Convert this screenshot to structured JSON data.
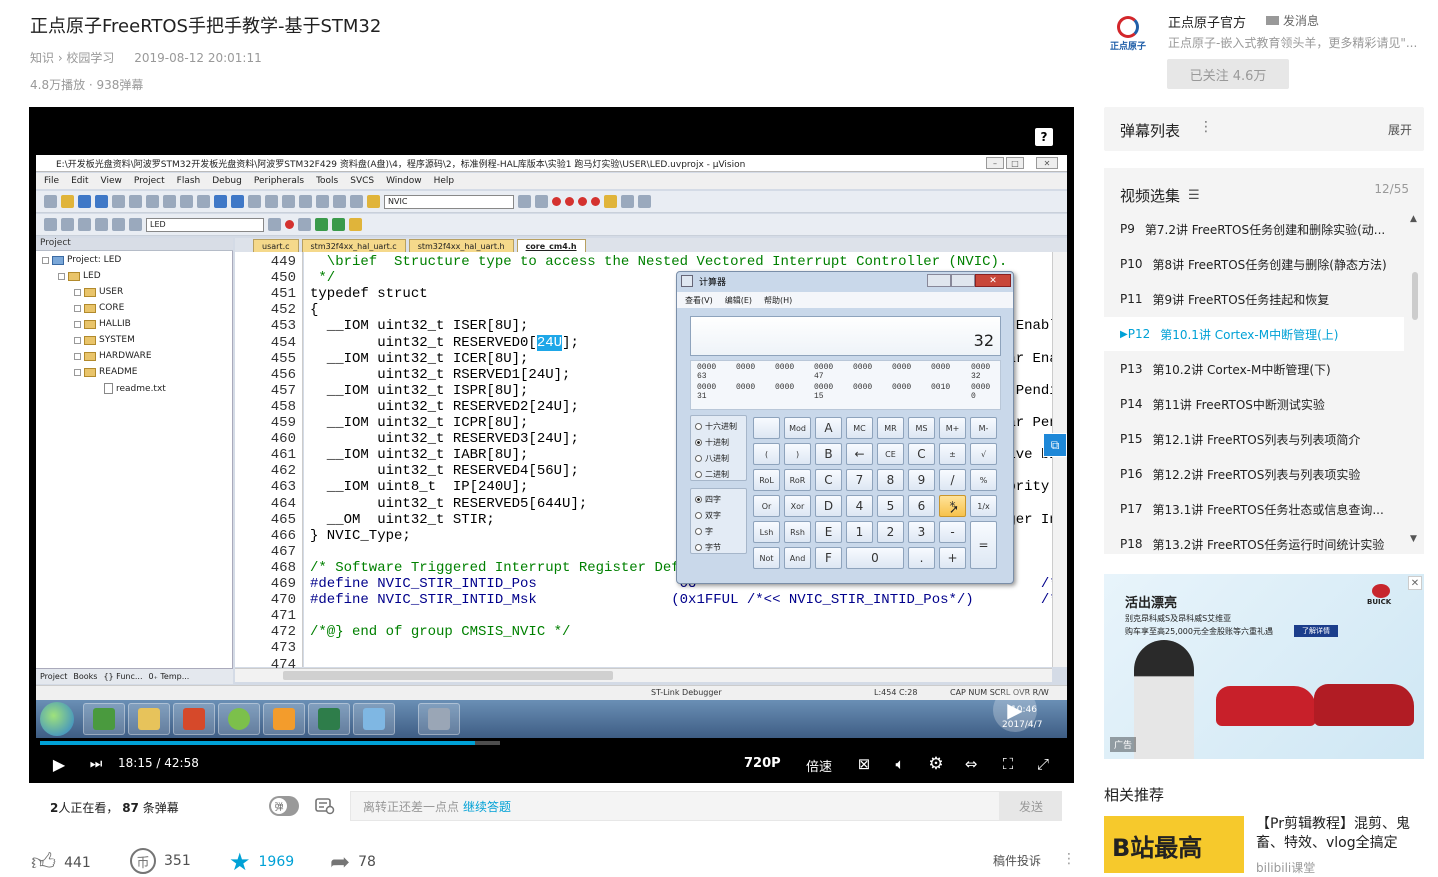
{
  "video": {
    "title": "正点原子FreeRTOS手把手教学-基于STM32",
    "category": "知识 › 校园学习",
    "date": "2019-08-12 20:01:11",
    "stats": "4.8万播放 · 938弹幕"
  },
  "uploader": {
    "avatar_text": "正点原子",
    "name": "正点原子官方",
    "message": "发消息",
    "desc": "正点原子-嵌入式教育领头羊，更多精彩请见\"...",
    "follow": "已关注 4.6万"
  },
  "player": {
    "help": "?",
    "time": "18:15 / 42:58",
    "quality": "720P",
    "speed": "倍速",
    "progress_fraction": 0.4247
  },
  "uvision": {
    "title": "E:\\开发板光盘资料\\阿波罗STM32开发板光盘资料\\阿波罗STM32F429 资料盘(A盘)\\4，程序源码\\2，标准例程-HAL库版本\\实验1 跑马灯实验\\USER\\LED.uvprojx - µVision",
    "menu": [
      "File",
      "Edit",
      "View",
      "Project",
      "Flash",
      "Debug",
      "Peripherals",
      "Tools",
      "SVCS",
      "Window",
      "Help"
    ],
    "toolbar_box1": "NVIC",
    "toolbar_box2": "LED",
    "project_header": "Project",
    "tree": [
      "Project: LED",
      "LED",
      "USER",
      "CORE",
      "HALLIB",
      "SYSTEM",
      "HARDWARE",
      "README",
      "readme.txt"
    ],
    "panel_tabs": [
      "Project",
      "Books",
      "{} Func...",
      "0₊ Temp..."
    ],
    "file_tabs": [
      "usart.c",
      "stm32f4xx_hal_uart.c",
      "stm32f4xx_hal_uart.h",
      "core_cm4.h"
    ],
    "line_numbers": [
      "449",
      "450",
      "451",
      "452",
      "453",
      "454",
      "455",
      "456",
      "457",
      "458",
      "459",
      "460",
      "461",
      "462",
      "463",
      "464",
      "465",
      "466",
      "467",
      "468",
      "469",
      "470",
      "471",
      "472",
      "473",
      "474"
    ],
    "code": [
      "  \\brief  Structure type to access the Nested Vectored Interrupt Controller (NVIC).",
      " */",
      "typedef struct",
      "{",
      "  __IOM uint32_t ISER[8U];                  /*!< Offset: 0x000 (R/W)  Interrupt Set Enable Regi",
      "        uint32_t RESERVED0[24U];",
      "  __IOM uint32_t ICER[8U];                  /*!< Offset: 0x080 (R/W)  Interrupt Clear Enable Re",
      "        uint32_t RSERVED1[24U];",
      "  __IOM uint32_t ISPR[8U];                  /*!< Offset: 0x100 (R/W)  Interrupt Set Pending Reg",
      "        uint32_t RESERVED2[24U];",
      "  __IOM uint32_t ICPR[8U];                  /*!< Offset: 0x180 (R/W)  Interrupt Clear Pending R",
      "        uint32_t RESERVED3[24U];",
      "  __IOM uint32_t IABR[8U];                  /*!< Offset: 0x200 (R/W)  Interrupt Active bit Regi",
      "        uint32_t RESERVED4[56U];",
      "  __IOM uint8_t  IP[240U];                  /*!< Offset: 0x300 (R/W)  Interrupt Priority Regist",
      "        uint32_t RESERVED5[644U];",
      "  __OM  uint32_t STIR;                      /*!< Offset: 0xE00 ( /W)  Software Trigger Interrup",
      "} NVIC_Type;",
      "",
      "/* Software Triggered Interrupt Register Definitions */",
      "#define NVIC_STIR_INTID_Pos                 0U                                         /*!<",
      "#define NVIC_STIR_INTID_Msk                (0x1FFUL /*<< NVIC_STIR_INTID_Pos*/)        /*!<",
      "",
      "/*@} end of group CMSIS_NVIC */",
      "",
      ""
    ],
    "status_debugger": "ST-Link Debugger",
    "status_pos": "L:454 C:28",
    "status_flags": "CAP  NUM  SCRL  OVR  R/W",
    "clock_time": "10:46",
    "clock_date": "2017/4/7"
  },
  "calculator": {
    "title": "计算器",
    "menu": [
      "查看(V)",
      "编辑(E)",
      "帮助(H)"
    ],
    "display": "32",
    "bits_row1": [
      "0000",
      "0000",
      "0000",
      "0000",
      "0000",
      "0000",
      "0000",
      "0000"
    ],
    "bits_lbl1": [
      "63",
      "",
      "",
      "47",
      "",
      "",
      "",
      "32"
    ],
    "bits_row2": [
      "0000",
      "0000",
      "0000",
      "0000",
      "0000",
      "0000",
      "0010",
      "0000"
    ],
    "bits_lbl2": [
      "31",
      "",
      "",
      "15",
      "",
      "",
      "",
      "0"
    ],
    "radix": [
      "十六进制",
      "十进制",
      "八进制",
      "二进制"
    ],
    "word": [
      "四字",
      "双字",
      "字",
      "字节"
    ],
    "keys": [
      [
        "",
        "Mod",
        "A",
        "MC",
        "MR",
        "MS",
        "M+",
        "M-"
      ],
      [
        "(",
        ")",
        "B",
        "←",
        "CE",
        "C",
        "±",
        "√"
      ],
      [
        "RoL",
        "RoR",
        "C",
        "7",
        "8",
        "9",
        "/",
        "%"
      ],
      [
        "Or",
        "Xor",
        "D",
        "4",
        "5",
        "6",
        "*",
        "1/x"
      ],
      [
        "Lsh",
        "Rsh",
        "E",
        "1",
        "2",
        "3",
        "-",
        "="
      ],
      [
        "Not",
        "And",
        "F",
        "0",
        ".",
        "+"
      ]
    ]
  },
  "danmaku_bar": {
    "viewers": "2",
    "viewers_suffix": "人正在看，",
    "danmaku_count": "87",
    "danmaku_suffix": "条弹幕",
    "toggle": "弹",
    "placeholder": "离转正还差一点点",
    "link": "继续答题",
    "send": "发送"
  },
  "actions": {
    "like": "441",
    "coin": "351",
    "favorite": "1969",
    "share": "78",
    "report": "稿件投诉"
  },
  "right": {
    "danmaku_list": "弹幕列表",
    "expand": "展开",
    "episodes_title": "视频选集",
    "episodes_count": "12/55",
    "episodes": [
      {
        "num": "P9",
        "title": "第7.2讲 FreeRTOS任务创建和删除实验(动..."
      },
      {
        "num": "P10",
        "title": "第8讲 FreeRTOS任务创建与删除(静态方法)"
      },
      {
        "num": "P11",
        "title": "第9讲 FreeRTOS任务挂起和恢复"
      },
      {
        "num": "P12",
        "title": "第10.1讲 Cortex-M中断管理(上)"
      },
      {
        "num": "P13",
        "title": "第10.2讲 Cortex-M中断管理(下)"
      },
      {
        "num": "P14",
        "title": "第11讲 FreeRTOS中断测试实验"
      },
      {
        "num": "P15",
        "title": "第12.1讲 FreeRTOS列表与列表项简介"
      },
      {
        "num": "P16",
        "title": "第12.2讲 FreeRTOS列表与列表项实验"
      },
      {
        "num": "P17",
        "title": "第13.1讲 FreeRTOS任务壮态或信息查询..."
      },
      {
        "num": "P18",
        "title": "第13.2讲 FreeRTOS任务运行时间统计实验"
      }
    ],
    "ad": {
      "title": "活出漂亮",
      "line1": "别克昂科威S及昂科威S艾维亚",
      "line2": "购车享至高25,000元全金股账等六重礼遇",
      "button": "了解详情",
      "brand": "BUICK",
      "tag": "广告",
      "close": "✕"
    },
    "related_title": "相关推荐",
    "related": {
      "thumb_text": "B站最高",
      "title": "【Pr剪辑教程】混剪、鬼畜、特效、vlog全搞定",
      "up": "bilibili课堂"
    }
  },
  "colors": {
    "accent": "#00a1d6",
    "calc_highlight": "#f7c24b",
    "editor_highlight": "#1ea7e8"
  }
}
